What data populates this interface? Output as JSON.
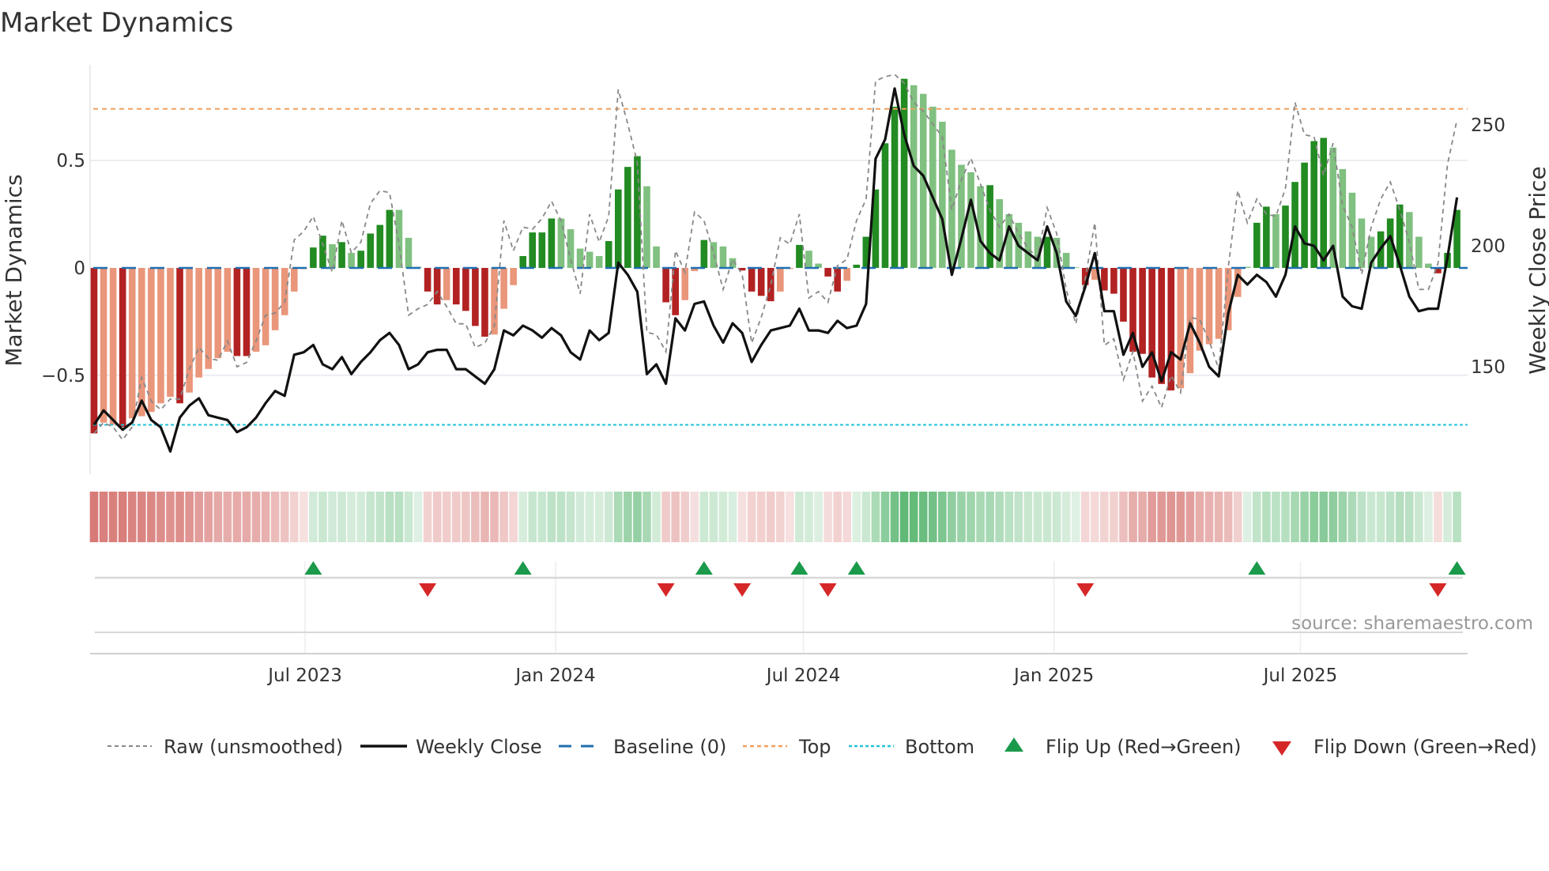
{
  "chart_data": {
    "type": "bar",
    "title": "Market Dynamics",
    "ylabel": "Market Dynamics",
    "y2label": "Weekly Close Price",
    "source": "source: sharemaestro.com",
    "start_date": "2023-01-27",
    "interval_days": 7,
    "ylim": [
      -0.96,
      0.945
    ],
    "y2lim": [
      105.6,
      274.8
    ],
    "yticks": [
      {
        "value": 0.5,
        "label": "0.5"
      },
      {
        "value": 0,
        "label": "0"
      },
      {
        "value": -0.5,
        "label": "−0.5"
      }
    ],
    "y2ticks": [
      {
        "value": 250,
        "label": "250"
      },
      {
        "value": 200,
        "label": "200"
      },
      {
        "value": 150,
        "label": "150"
      }
    ],
    "xticks": [
      {
        "date": "2023-07-01",
        "label": "Jul 2023"
      },
      {
        "date": "2024-01-01",
        "label": "Jan 2024"
      },
      {
        "date": "2024-07-01",
        "label": "Jul 2024"
      },
      {
        "date": "2025-01-01",
        "label": "Jan 2025"
      },
      {
        "date": "2025-07-01",
        "label": "Jul 2025"
      }
    ],
    "top": 0.74,
    "bottom": -0.73,
    "baseline": 0,
    "bars": [
      -0.77,
      -0.72,
      -0.73,
      -0.74,
      -0.7,
      -0.69,
      -0.67,
      -0.63,
      -0.6,
      -0.63,
      -0.58,
      -0.51,
      -0.47,
      -0.42,
      -0.39,
      -0.41,
      -0.41,
      -0.39,
      -0.36,
      -0.29,
      -0.22,
      -0.11,
      -0.005,
      0.095,
      0.15,
      0.11,
      0.12,
      0.07,
      0.08,
      0.16,
      0.2,
      0.27,
      0.27,
      0.14,
      0.005,
      -0.11,
      -0.17,
      -0.15,
      -0.17,
      -0.2,
      -0.27,
      -0.32,
      -0.31,
      -0.19,
      -0.08,
      0.055,
      0.165,
      0.165,
      0.23,
      0.23,
      0.18,
      0.09,
      0.075,
      0.055,
      0.125,
      0.365,
      0.47,
      0.52,
      0.38,
      0.1,
      -0.16,
      -0.22,
      -0.15,
      -0.015,
      0.13,
      0.12,
      0.1,
      0.045,
      -0.012,
      -0.11,
      -0.13,
      -0.155,
      -0.11,
      -0.005,
      0.107,
      0.08,
      0.02,
      -0.04,
      -0.11,
      -0.06,
      0.015,
      0.145,
      0.365,
      0.58,
      0.75,
      0.88,
      0.85,
      0.81,
      0.75,
      0.68,
      0.55,
      0.48,
      0.445,
      0.38,
      0.385,
      0.32,
      0.25,
      0.21,
      0.17,
      0.145,
      0.145,
      0.14,
      0.07,
      0.003,
      -0.08,
      -0.055,
      -0.105,
      -0.12,
      -0.25,
      -0.39,
      -0.4,
      -0.51,
      -0.54,
      -0.57,
      -0.56,
      -0.49,
      -0.385,
      -0.355,
      -0.33,
      -0.29,
      -0.135,
      0.005,
      0.21,
      0.285,
      0.25,
      0.29,
      0.4,
      0.49,
      0.59,
      0.605,
      0.56,
      0.46,
      0.35,
      0.23,
      0.145,
      0.17,
      0.23,
      0.295,
      0.26,
      0.145,
      0.02,
      -0.025,
      0.07,
      0.27
    ],
    "bar_strong": [
      1,
      0,
      0,
      1,
      0,
      0,
      0,
      0,
      0,
      1,
      0,
      0,
      0,
      0,
      0,
      1,
      1,
      0,
      0,
      0,
      0,
      0,
      0,
      1,
      1,
      0,
      1,
      0,
      1,
      1,
      1,
      1,
      0,
      0,
      0,
      1,
      1,
      0,
      1,
      1,
      1,
      1,
      0,
      0,
      0,
      1,
      1,
      1,
      1,
      0,
      0,
      0,
      0,
      0,
      1,
      1,
      1,
      1,
      0,
      0,
      1,
      1,
      0,
      0,
      1,
      0,
      0,
      0,
      1,
      1,
      1,
      1,
      0,
      0,
      1,
      0,
      0,
      1,
      1,
      0,
      1,
      1,
      1,
      1,
      1,
      1,
      0,
      0,
      0,
      0,
      0,
      0,
      0,
      0,
      1,
      0,
      0,
      0,
      0,
      0,
      1,
      0,
      0,
      0,
      1,
      0,
      1,
      1,
      1,
      1,
      1,
      1,
      1,
      1,
      0,
      0,
      0,
      0,
      0,
      0,
      0,
      0,
      1,
      1,
      0,
      1,
      1,
      1,
      1,
      1,
      0,
      0,
      0,
      0,
      0,
      1,
      1,
      1,
      0,
      0,
      0,
      1,
      1,
      1
    ],
    "raw": [
      -0.77,
      -0.72,
      -0.74,
      -0.8,
      -0.74,
      -0.51,
      -0.62,
      -0.66,
      -0.61,
      -0.61,
      -0.47,
      -0.37,
      -0.42,
      -0.43,
      -0.34,
      -0.46,
      -0.44,
      -0.34,
      -0.22,
      -0.21,
      -0.16,
      0.13,
      0.17,
      0.24,
      0.11,
      -0.02,
      0.22,
      0.07,
      0.12,
      0.3,
      0.36,
      0.35,
      0.11,
      -0.22,
      -0.19,
      -0.17,
      -0.11,
      -0.18,
      -0.26,
      -0.26,
      -0.37,
      -0.35,
      -0.27,
      0.22,
      0.08,
      0.19,
      0.18,
      0.23,
      0.31,
      0.22,
      0.04,
      -0.12,
      0.25,
      0.12,
      0.24,
      0.83,
      0.67,
      0.49,
      -0.3,
      -0.31,
      -0.39,
      0.08,
      -0.02,
      0.26,
      0.22,
      0.07,
      -0.1,
      0.04,
      -0.03,
      -0.35,
      -0.23,
      -0.08,
      0.14,
      0.11,
      0.25,
      -0.14,
      -0.11,
      -0.16,
      0.01,
      0.04,
      0.22,
      0.32,
      0.87,
      0.89,
      0.9,
      0.86,
      0.77,
      0.73,
      0.67,
      0.61,
      0.27,
      0.41,
      0.51,
      0.39,
      0.27,
      0.19,
      0.25,
      0.16,
      0.09,
      0.05,
      0.28,
      0.16,
      -0.1,
      -0.26,
      -0.05,
      0.21,
      -0.36,
      -0.33,
      -0.52,
      -0.39,
      -0.62,
      -0.55,
      -0.65,
      -0.5,
      -0.58,
      -0.23,
      -0.24,
      -0.34,
      -0.47,
      0.0,
      0.36,
      0.21,
      0.32,
      0.25,
      0.24,
      0.37,
      0.77,
      0.62,
      0.61,
      0.43,
      0.58,
      0.29,
      0.19,
      -0.03,
      0.19,
      0.32,
      0.4,
      0.27,
      0.12,
      -0.1,
      -0.1,
      0.02,
      0.48,
      0.69
    ],
    "close": [
      126,
      132,
      128,
      124,
      127,
      136,
      128,
      125,
      115,
      129,
      134,
      137,
      130,
      129,
      128,
      123,
      125,
      129,
      135,
      140,
      138,
      155,
      156,
      159,
      151,
      149,
      154,
      147,
      152,
      156,
      161,
      164,
      159,
      149,
      151,
      156,
      157,
      157,
      149,
      149,
      146,
      143,
      149,
      165,
      163,
      167,
      165,
      162,
      166,
      163,
      156,
      153,
      165,
      161,
      164,
      193,
      188,
      181,
      147,
      151,
      143,
      170,
      165,
      176,
      177,
      167,
      160,
      168,
      164,
      152,
      159,
      165,
      166,
      167,
      174,
      165,
      165,
      164,
      169,
      166,
      167,
      176,
      236,
      244,
      265,
      246,
      233,
      229,
      220,
      211,
      188,
      203,
      219,
      202,
      197,
      194,
      208,
      200,
      197,
      194,
      208,
      197,
      177,
      171,
      183,
      197,
      173,
      173,
      155,
      164,
      150,
      156,
      144,
      156,
      153,
      168,
      160,
      150,
      146,
      172,
      188,
      184,
      188,
      185,
      179,
      188,
      208,
      201,
      200,
      194,
      200,
      179,
      175,
      174,
      193,
      199,
      204,
      192,
      179,
      173,
      174,
      174,
      195,
      220
    ],
    "flips_up": [
      23,
      45,
      64,
      74,
      80,
      122,
      143
    ],
    "flips_down": [
      35,
      60,
      68,
      77,
      104,
      141
    ],
    "colors": {
      "strong_pos": "#228b22",
      "weak_pos": "#80c080",
      "strong_neg": "#b22222",
      "weak_neg": "#e9967a",
      "raw": "#888888",
      "close": "#111111",
      "baseline": "#1f6fb0",
      "top": "#f0a060",
      "bottom": "#22c3d8",
      "flip_up": "#1a9a4a",
      "flip_down": "#d62728"
    },
    "legend": [
      {
        "label": "Raw (unsmoothed)"
      },
      {
        "label": "Weekly Close"
      },
      {
        "label": "Baseline (0)"
      },
      {
        "label": "Top"
      },
      {
        "label": "Bottom"
      },
      {
        "label": "Flip Up (Red→Green)"
      },
      {
        "label": "Flip Down (Green→Red)"
      }
    ]
  }
}
